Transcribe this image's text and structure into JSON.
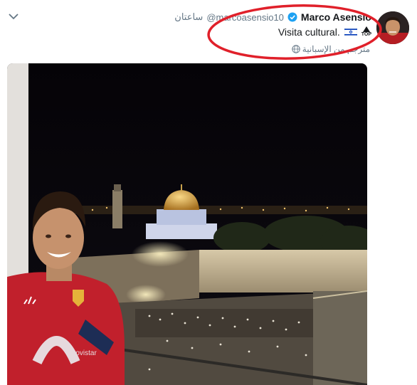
{
  "tweet": {
    "display_name": "Marco Asensio",
    "handle": "@marcoasensio10",
    "timestamp": "ساعتان",
    "text": "Visita cultural.",
    "top_badge": "TOP",
    "translate_label": "مترجم من الإسبانية",
    "shirt_text": "movistar"
  },
  "icons": {
    "menu": "chevron-down-icon",
    "verified": "verified-badge-icon",
    "flag": "israel-flag-icon",
    "top": "top-arrow-icon",
    "translate": "globe-icon"
  },
  "colors": {
    "highlight": "#e0202a",
    "verified": "#1da1f2",
    "secondary_text": "#657786",
    "primary_text": "#14171a"
  }
}
